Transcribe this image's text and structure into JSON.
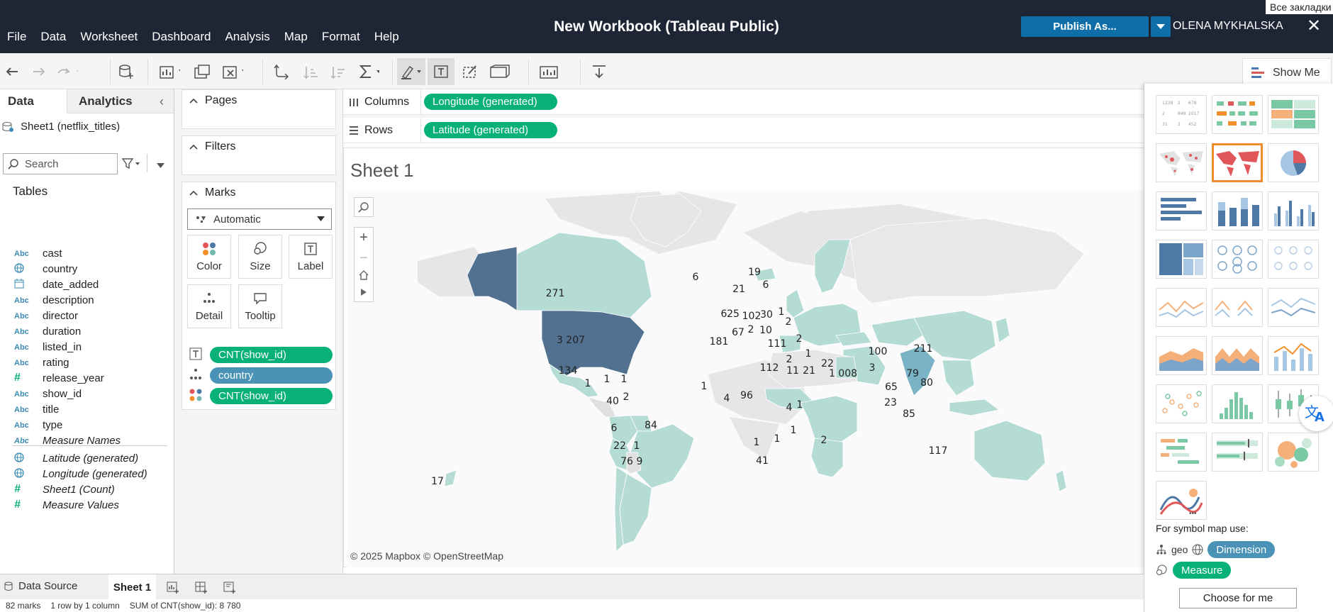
{
  "app": {
    "title": "New Workbook (Tableau Public)",
    "publish_label": "Publish As...",
    "user": "OLENA MYKHALSKA",
    "bookmarks": "Все закладки"
  },
  "menu": [
    "File",
    "Data",
    "Worksheet",
    "Dashboard",
    "Analysis",
    "Map",
    "Format",
    "Help"
  ],
  "toolbar": {
    "show_me": "Show Me"
  },
  "data_pane": {
    "tabs": [
      "Data",
      "Analytics"
    ],
    "source": "Sheet1 (netflix_titles)",
    "search_placeholder": "Search",
    "tables_heading": "Tables",
    "fields": [
      {
        "type": "Abc",
        "name": "cast"
      },
      {
        "type": "geo",
        "name": "country"
      },
      {
        "type": "date",
        "name": "date_added"
      },
      {
        "type": "Abc",
        "name": "description"
      },
      {
        "type": "Abc",
        "name": "director"
      },
      {
        "type": "Abc",
        "name": "duration"
      },
      {
        "type": "Abc",
        "name": "listed_in"
      },
      {
        "type": "Abc",
        "name": "rating"
      },
      {
        "type": "#",
        "name": "release_year"
      },
      {
        "type": "Abc",
        "name": "show_id"
      },
      {
        "type": "Abc",
        "name": "title"
      },
      {
        "type": "Abc",
        "name": "type"
      },
      {
        "type": "Abc",
        "name": "Measure Names"
      },
      {
        "type": "geo",
        "name": "Latitude (generated)"
      },
      {
        "type": "geo",
        "name": "Longitude (generated)"
      },
      {
        "type": "#",
        "name": "Sheet1 (Count)"
      },
      {
        "type": "#",
        "name": "Measure Values"
      }
    ]
  },
  "cards": {
    "pages": "Pages",
    "filters": "Filters",
    "marks": "Marks",
    "mark_type": "Automatic",
    "buttons": [
      "Color",
      "Size",
      "Label",
      "Detail",
      "Tooltip"
    ],
    "pills": [
      "CNT(show_id)",
      "country",
      "CNT(show_id)"
    ]
  },
  "shelves": {
    "columns_label": "Columns",
    "columns_pill": "Longitude (generated)",
    "rows_label": "Rows",
    "rows_pill": "Latitude (generated)"
  },
  "sheet": {
    "title": "Sheet 1",
    "attribution": "© 2025 Mapbox  © OpenStreetMap"
  },
  "map_labels": [
    {
      "t": "271",
      "c": "canada"
    },
    {
      "t": "3 207",
      "c": "usa"
    },
    {
      "t": "134",
      "c": "mexico"
    },
    {
      "t": "1",
      "c": "guatemala"
    },
    {
      "t": "1",
      "c": "cuba"
    },
    {
      "t": "1",
      "c": "jamaica"
    },
    {
      "t": "40",
      "c": "colombia"
    },
    {
      "t": "2",
      "c": "venezuela"
    },
    {
      "t": "6",
      "c": "peru"
    },
    {
      "t": "84",
      "c": "brazil"
    },
    {
      "t": "22",
      "c": "chile"
    },
    {
      "t": "1",
      "c": "paraguay"
    },
    {
      "t": "76",
      "c": "argentina"
    },
    {
      "t": "9",
      "c": "uruguay"
    },
    {
      "t": "17",
      "c": "falklands"
    },
    {
      "t": "6",
      "c": "iceland"
    },
    {
      "t": "19",
      "c": "norway"
    },
    {
      "t": "21",
      "c": "sweden"
    },
    {
      "t": "6",
      "c": "finland"
    },
    {
      "t": "6",
      "c": "ireland"
    },
    {
      "t": "25",
      "c": "uk"
    },
    {
      "t": "102",
      "c": "germany"
    },
    {
      "t": "30",
      "c": "poland"
    },
    {
      "t": "1",
      "c": "belarus"
    },
    {
      "t": "2",
      "c": "ukraine"
    },
    {
      "t": "67",
      "c": "france"
    },
    {
      "t": "2",
      "c": "switzerland"
    },
    {
      "t": "10",
      "c": "hungary"
    },
    {
      "t": "181",
      "c": "spain"
    },
    {
      "t": "111",
      "c": "turkey"
    },
    {
      "t": "2",
      "c": "georgia"
    },
    {
      "t": "1",
      "c": "kazakhstan"
    },
    {
      "t": "2",
      "c": "lebanon"
    },
    {
      "t": "112",
      "c": "egypt"
    },
    {
      "t": "11",
      "c": "saudi"
    },
    {
      "t": "21",
      "c": "uae"
    },
    {
      "t": "22",
      "c": "pakistan"
    },
    {
      "t": "1 008",
      "c": "india"
    },
    {
      "t": "3",
      "c": "bangladesh"
    },
    {
      "t": "100",
      "c": "china"
    },
    {
      "t": "211",
      "c": "japan"
    },
    {
      "t": "79",
      "c": "taiwan"
    },
    {
      "t": "80",
      "c": "philippines"
    },
    {
      "t": "65",
      "c": "thailand"
    },
    {
      "t": "23",
      "c": "malaysia"
    },
    {
      "t": "85",
      "c": "indonesia"
    },
    {
      "t": "1",
      "c": "senegal"
    },
    {
      "t": "4",
      "c": "ghana"
    },
    {
      "t": "96",
      "c": "nigeria"
    },
    {
      "t": "4",
      "c": "uganda"
    },
    {
      "t": "1",
      "c": "kenya"
    },
    {
      "t": "1",
      "c": "malawi"
    },
    {
      "t": "1",
      "c": "namibia"
    },
    {
      "t": "1",
      "c": "zimbabwe"
    },
    {
      "t": "41",
      "c": "south_africa"
    },
    {
      "t": "2",
      "c": "mauritius"
    },
    {
      "t": "117",
      "c": "australia"
    }
  ],
  "show_me": {
    "symbol_hint": "For symbol map use:",
    "geo": "geo",
    "dimension": "Dimension",
    "measure": "Measure",
    "choose": "Choose for me"
  },
  "bottom_tabs": [
    "Data Source",
    "Sheet 1"
  ],
  "status": [
    "82 marks",
    "1 row by 1 column",
    "SUM of CNT(show_id): 8 780"
  ],
  "colors": {
    "topbar": "#1e2535",
    "accent_green": "#08b177",
    "accent_blue": "#4a93b7",
    "usa_fill": "#52708f",
    "country_fill": "#b5dbd5",
    "selected_thumb": "#f08c2f"
  }
}
